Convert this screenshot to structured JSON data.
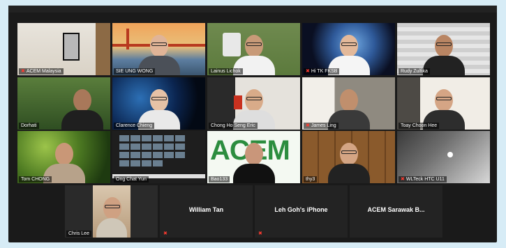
{
  "participants": [
    {
      "name": "ACEM Malaysia",
      "muted": true
    },
    {
      "name": "SIE UNG WONG",
      "muted": false
    },
    {
      "name": "Lainus Lichok",
      "muted": false
    },
    {
      "name": "Hi TK FKSB",
      "muted": true
    },
    {
      "name": "Rudy Zulfika",
      "muted": false
    },
    {
      "name": "Dorhati",
      "muted": false
    },
    {
      "name": "Clarence Chieng",
      "muted": false
    },
    {
      "name": "Chong Ho Seng Eric",
      "muted": false
    },
    {
      "name": "James Ling",
      "muted": true
    },
    {
      "name": "Toay Choon Hee",
      "muted": false
    },
    {
      "name": "Tom CHONG",
      "muted": false
    },
    {
      "name": "Ong Chat Yun",
      "muted": false
    },
    {
      "name": "Bao133",
      "muted": false
    },
    {
      "name": "thy3",
      "muted": false
    },
    {
      "name": "WLTeck HTC U11",
      "muted": true
    },
    {
      "name": "Chris Lee",
      "muted": false
    },
    {
      "name": "William Tan",
      "muted": true
    },
    {
      "name": "Leh Goh's iPhone",
      "muted": true
    },
    {
      "name": "ACEM Sarawak B...",
      "muted": false
    }
  ],
  "active_speaker": "Lainus Lichok",
  "screen_text": {
    "acem_logo": "ACEM"
  },
  "colors": {
    "active_border": "#b7d84a",
    "mute_icon": "#ff3b30",
    "background": "#d7ecf6"
  }
}
